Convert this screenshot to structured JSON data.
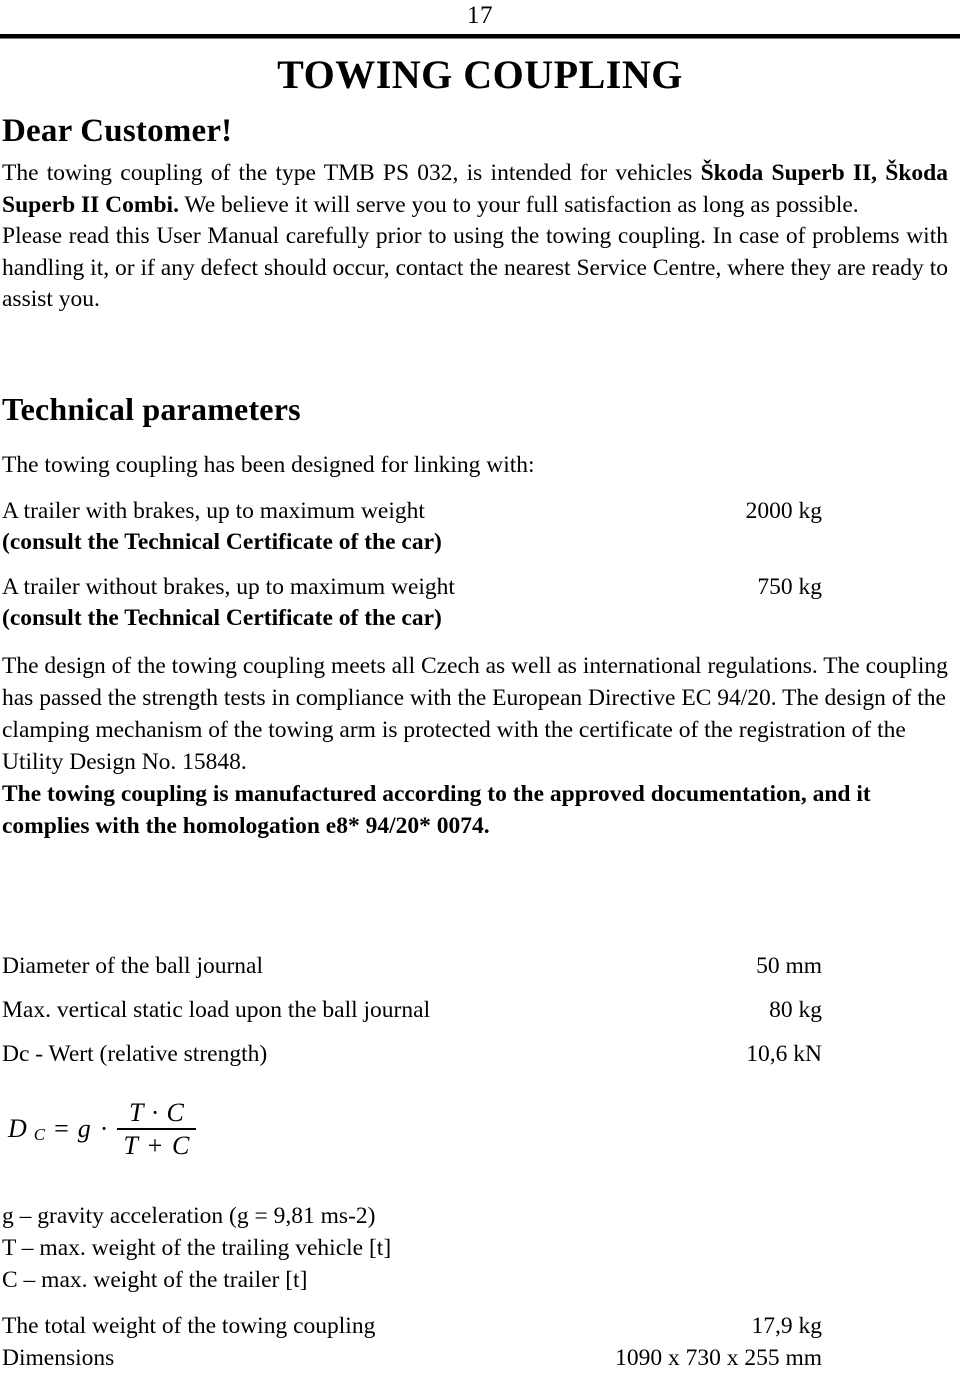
{
  "page": {
    "number": "17",
    "title": "TOWING COUPLING",
    "salutation": "Dear Customer!"
  },
  "intro": {
    "line1_a": "The towing coupling of the type TMB PS 032, is intended for vehicles ",
    "line1_b": "Škoda Superb II, Škoda Superb II Combi.",
    "line1_c": " We believe it will serve you to your full satisfaction as long as possible.",
    "paragraph2": "Please read this User Manual carefully prior to using the towing coupling. In case of problems with handling it, or if any defect should occur, contact the nearest Service Centre, where they are ready to assist you."
  },
  "technical": {
    "heading": "Technical parameters",
    "designed_for": "The towing coupling has been designed for linking with:",
    "rows": [
      {
        "label": "A trailer with brakes, up to maximum weight",
        "sub": "(consult the Technical Certificate of the car)",
        "value": "2000 kg"
      },
      {
        "label": "A trailer without brakes, up to maximum weight",
        "sub": "(consult the Technical Certificate of the car)",
        "value": "750 kg"
      }
    ]
  },
  "regulations": {
    "paragraph": "The design of the towing coupling meets all Czech as well as international regulations. The coupling has passed the strength tests in compliance with the European Directive EC 94/20. The design of the clamping mechanism of the towing arm is protected with the certificate of the registration of the Utility Design No. 15848.",
    "bold_paragraph": "The towing coupling is manufactured according to the approved documentation, and it complies with the homologation e8* 94/20* 0074."
  },
  "ball_specs": [
    {
      "label": "Diameter of the ball journal",
      "value": "50 mm"
    },
    {
      "label": "Max. vertical static load upon the ball journal",
      "value": "80 kg"
    },
    {
      "label": "Dc - Wert (relative strength)",
      "value": "10,6 kN"
    }
  ],
  "formula": {
    "lhs_var": "D",
    "lhs_sub": "C",
    "equals": "=",
    "gravity": "g",
    "dot": "·",
    "numerator": "T · C",
    "denominator": "T + C"
  },
  "legend": [
    "g – gravity acceleration (g = 9,81 ms-2)",
    "T – max. weight of the trailing vehicle [t]",
    "C – max. weight of the trailer [t]"
  ],
  "totals": [
    {
      "label": "The total weight of the towing coupling",
      "value": "17,9 kg"
    },
    {
      "label": "Dimensions",
      "value": "1090 x 730 x 255 mm"
    }
  ]
}
